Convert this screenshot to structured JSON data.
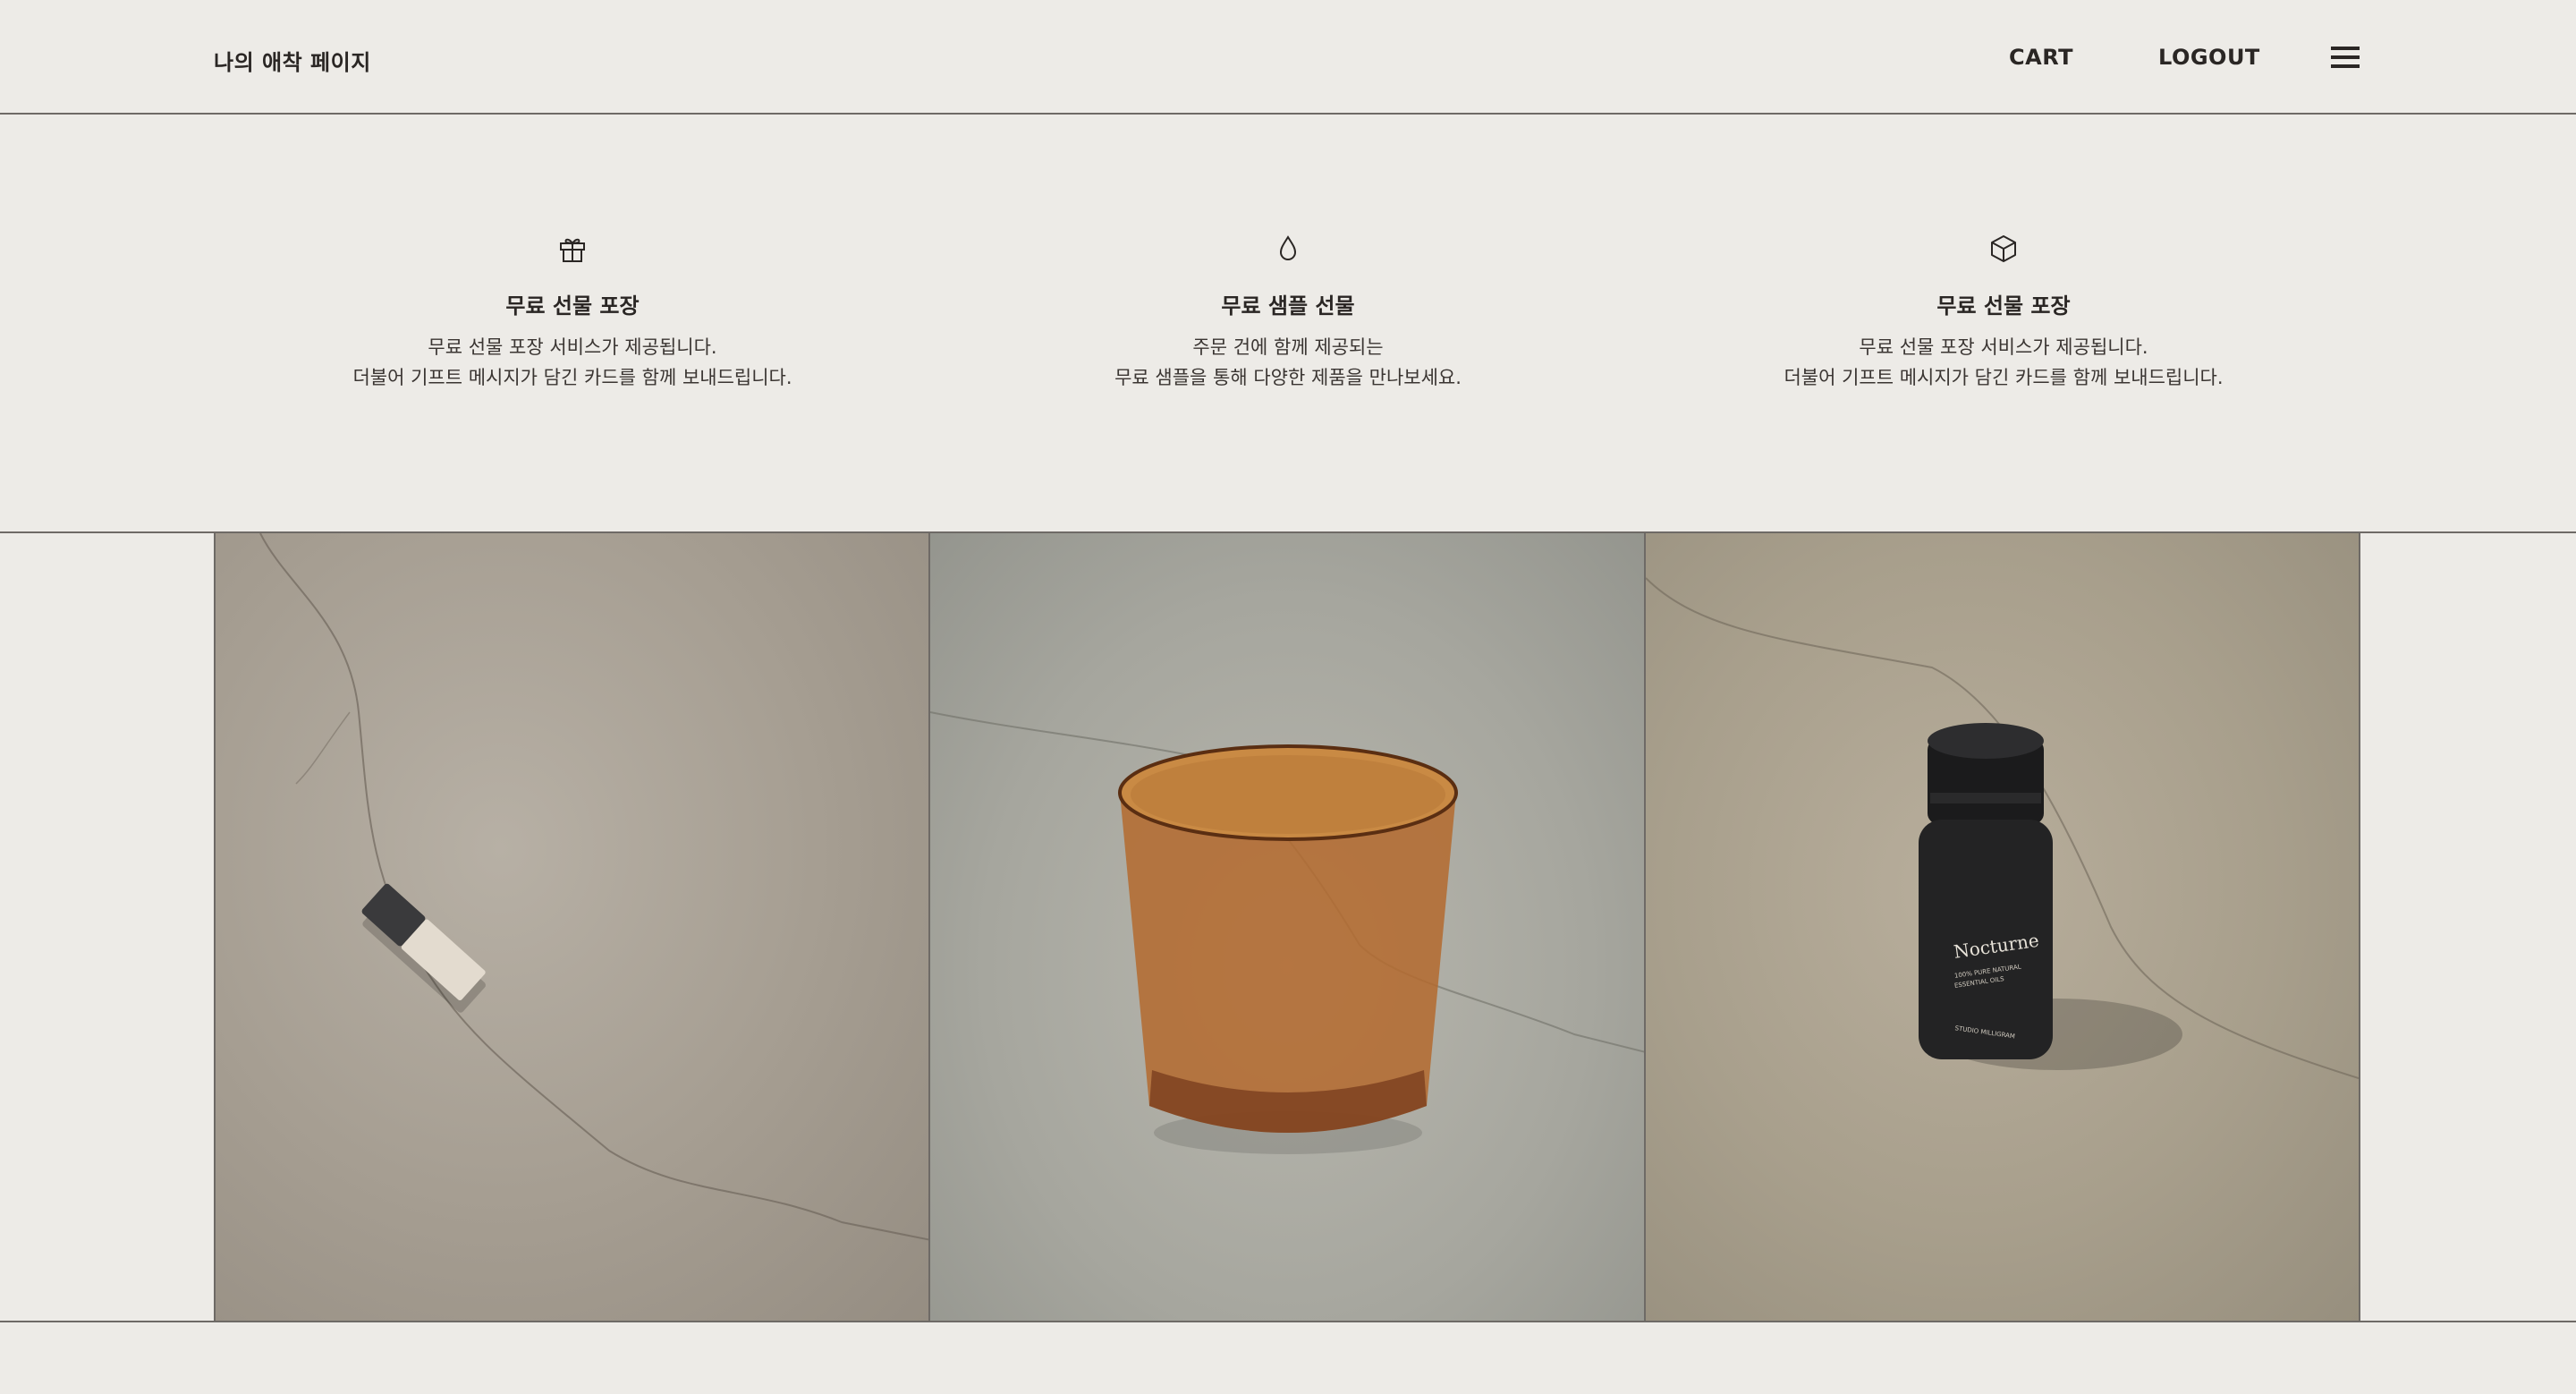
{
  "header": {
    "brand": "나의 애착 페이지",
    "nav": {
      "cart": "CART",
      "logout": "LOGOUT"
    }
  },
  "features": [
    {
      "icon": "gift-icon",
      "title": "무료 선물 포장",
      "desc_line1": "무료 선물 포장 서비스가 제공됩니다.",
      "desc_line2": "더불어 기프트 메시지가 담긴 카드를 함께 보내드립니다."
    },
    {
      "icon": "drop-icon",
      "title": "무료 샘플 선물",
      "desc_line1": "주문 건에 함께 제공되는",
      "desc_line2": "무료 샘플을 통해 다양한 제품을 만나보세요."
    },
    {
      "icon": "box-icon",
      "title": "무료 선물 포장",
      "desc_line1": "무료 선물 포장 서비스가 제공됩니다.",
      "desc_line2": "더불어 기프트 메시지가 담긴 카드를 함께 보내드립니다."
    }
  ],
  "gallery": {
    "products": [
      {
        "name": "incense-stick-photo"
      },
      {
        "name": "amber-glass-photo"
      },
      {
        "name": "essential-oil-bottle-photo",
        "bottle_label": "Nocturne",
        "bottle_sub1": "100% PURE NATURAL",
        "bottle_sub2": "ESSENTIAL OILS",
        "bottle_brand": "STUDIO MILLIGRAM"
      }
    ]
  },
  "colors": {
    "background": "#edebe7",
    "text": "#2a2624",
    "divider": "#6e6a66"
  }
}
